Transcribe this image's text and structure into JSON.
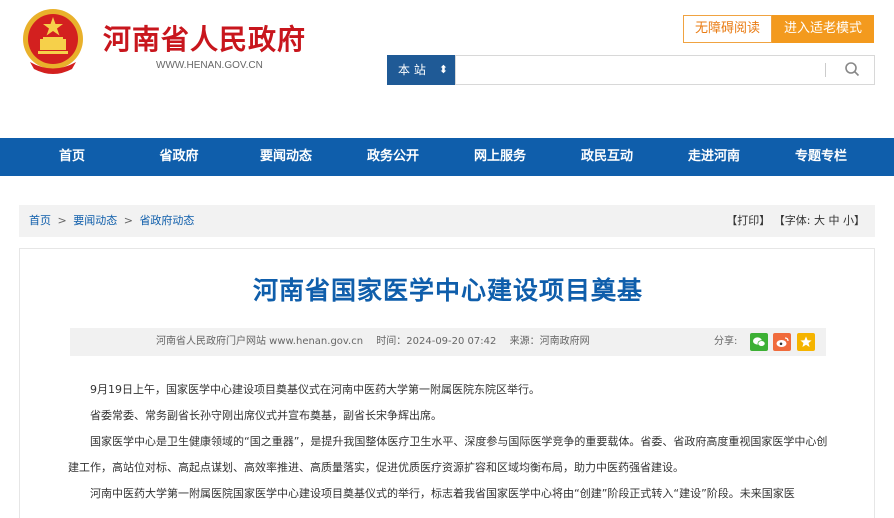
{
  "header": {
    "site_title": "河南省人民政府",
    "site_url": "WWW.HENAN.GOV.CN",
    "accessibility_button": "无障碍阅读",
    "elder_mode_button": "进入适老模式"
  },
  "search": {
    "scope": "本 站",
    "placeholder": ""
  },
  "nav": {
    "items": [
      "首页",
      "省政府",
      "要闻动态",
      "政务公开",
      "网上服务",
      "政民互动",
      "走进河南",
      "专题专栏"
    ]
  },
  "breadcrumb": {
    "items": [
      "首页",
      "要闻动态",
      "省政府动态"
    ],
    "separator": ">"
  },
  "tools": {
    "print": "【打印】",
    "font_label": "【字体:",
    "font_large": "大",
    "font_medium": "中",
    "font_small": "小",
    "font_end": "】"
  },
  "article": {
    "title": "河南省国家医学中心建设项目奠基",
    "source_site": "河南省人民政府门户网站 www.henan.gov.cn",
    "time": "时间：2024-09-20 07:42",
    "origin": "来源：河南政府网",
    "share_label": "分享:",
    "paragraphs": [
      "9月19日上午，国家医学中心建设项目奠基仪式在河南中医药大学第一附属医院东院区举行。",
      "省委常委、常务副省长孙守刚出席仪式并宣布奠基，副省长宋争辉出席。",
      "国家医学中心是卫生健康领域的“国之重器”，是提升我国整体医疗卫生水平、深度参与国际医学竞争的重要载体。省委、省政府高度重视国家医学中心创建工作，高站位对标、高起点谋划、高效率推进、高质量落实，促进优质医疗资源扩容和区域均衡布局，助力中医药强省建设。",
      "河南中医药大学第一附属医院国家医学中心建设项目奠基仪式的举行，标志着我省国家医学中心将由“创建”阶段正式转入“建设”阶段。未来国家医"
    ]
  },
  "colors": {
    "brand_red": "#c8161d",
    "nav_blue": "#0f5eab",
    "accent_orange": "#f39a1e"
  }
}
